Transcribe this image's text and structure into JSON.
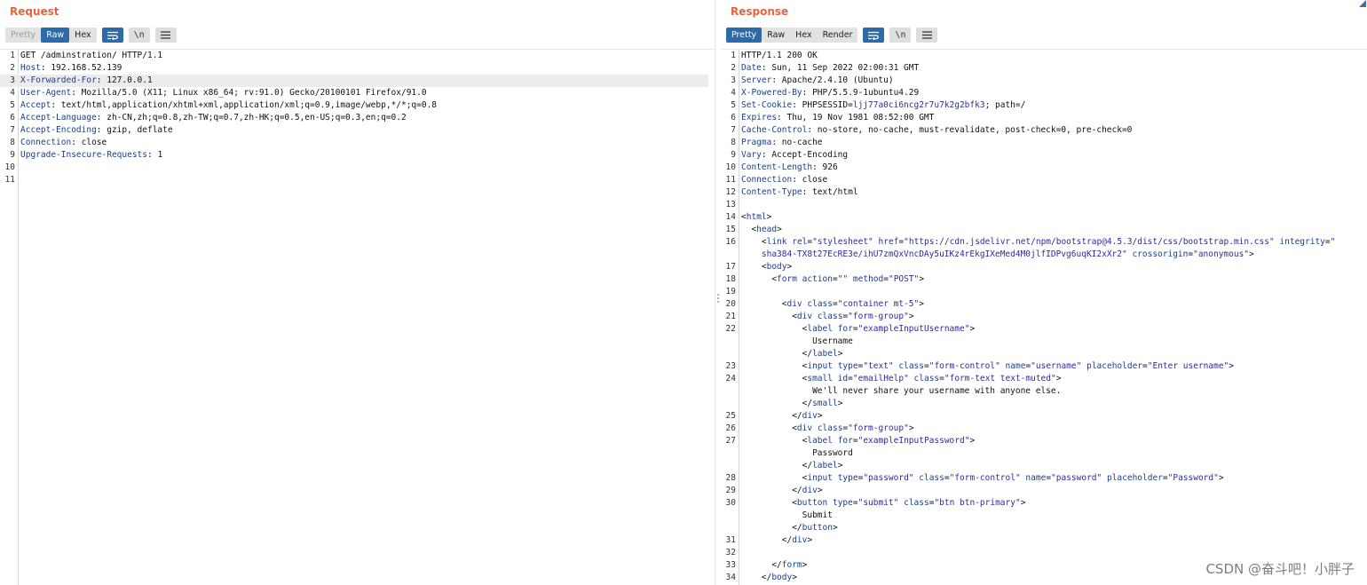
{
  "request": {
    "title": "Request",
    "tabs": [
      {
        "label": "Pretty",
        "state": "disabled"
      },
      {
        "label": "Raw",
        "state": "active"
      },
      {
        "label": "Hex",
        "state": "normal"
      }
    ],
    "newline_label": "\\n",
    "lines": [
      {
        "n": "1",
        "segs": [
          {
            "t": "GET /adminstration/ HTTP/1.1"
          }
        ]
      },
      {
        "n": "2",
        "segs": [
          {
            "t": "Host",
            "c": "hk"
          },
          {
            "t": ": 192.168.52.139"
          }
        ]
      },
      {
        "n": "3",
        "hl": true,
        "segs": [
          {
            "t": "X-Forwarded-For",
            "c": "hk"
          },
          {
            "t": ": 127.0.0.1"
          }
        ]
      },
      {
        "n": "4",
        "segs": [
          {
            "t": "User-Agent",
            "c": "hk"
          },
          {
            "t": ": Mozilla/5.0 (X11; Linux x86_64; rv:91.0) Gecko/20100101 Firefox/91.0"
          }
        ]
      },
      {
        "n": "5",
        "segs": [
          {
            "t": "Accept",
            "c": "hk"
          },
          {
            "t": ": text/html,application/xhtml+xml,application/xml;q=0.9,image/webp,*/*;q=0.8"
          }
        ]
      },
      {
        "n": "6",
        "segs": [
          {
            "t": "Accept-Language",
            "c": "hk"
          },
          {
            "t": ": zh-CN,zh;q=0.8,zh-TW;q=0.7,zh-HK;q=0.5,en-US;q=0.3,en;q=0.2"
          }
        ]
      },
      {
        "n": "7",
        "segs": [
          {
            "t": "Accept-Encoding",
            "c": "hk"
          },
          {
            "t": ": gzip, deflate"
          }
        ]
      },
      {
        "n": "8",
        "segs": [
          {
            "t": "Connection",
            "c": "hk"
          },
          {
            "t": ": close"
          }
        ]
      },
      {
        "n": "9",
        "segs": [
          {
            "t": "Upgrade-Insecure-Requests",
            "c": "hk"
          },
          {
            "t": ": 1"
          }
        ]
      },
      {
        "n": "10",
        "segs": []
      },
      {
        "n": "11",
        "segs": []
      }
    ]
  },
  "response": {
    "title": "Response",
    "tabs": [
      {
        "label": "Pretty",
        "state": "active"
      },
      {
        "label": "Raw",
        "state": "normal"
      },
      {
        "label": "Hex",
        "state": "normal"
      },
      {
        "label": "Render",
        "state": "normal"
      }
    ],
    "newline_label": "\\n",
    "lines": [
      {
        "n": "1",
        "segs": [
          {
            "t": "HTTP/1.1 200 OK"
          }
        ]
      },
      {
        "n": "2",
        "segs": [
          {
            "t": "Date",
            "c": "hk"
          },
          {
            "t": ": Sun, 11 Sep 2022 02:00:31 GMT"
          }
        ]
      },
      {
        "n": "3",
        "segs": [
          {
            "t": "Server",
            "c": "hk"
          },
          {
            "t": ": Apache/2.4.10 (Ubuntu)"
          }
        ]
      },
      {
        "n": "4",
        "segs": [
          {
            "t": "X-Powered-By",
            "c": "hk"
          },
          {
            "t": ": PHP/5.5.9-1ubuntu4.29"
          }
        ]
      },
      {
        "n": "5",
        "segs": [
          {
            "t": "Set-Cookie",
            "c": "hk"
          },
          {
            "t": ": PHPSESSID="
          },
          {
            "t": "ljj77a0ci6ncg2r7u7k2g2bfk3",
            "c": "av"
          },
          {
            "t": "; path=/"
          }
        ]
      },
      {
        "n": "6",
        "segs": [
          {
            "t": "Expires",
            "c": "hk"
          },
          {
            "t": ": Thu, 19 Nov 1981 08:52:00 GMT"
          }
        ]
      },
      {
        "n": "7",
        "segs": [
          {
            "t": "Cache-Control",
            "c": "hk"
          },
          {
            "t": ": no-store, no-cache, must-revalidate, post-check=0, pre-check=0"
          }
        ]
      },
      {
        "n": "8",
        "segs": [
          {
            "t": "Pragma",
            "c": "hk"
          },
          {
            "t": ": no-cache"
          }
        ]
      },
      {
        "n": "9",
        "segs": [
          {
            "t": "Vary",
            "c": "hk"
          },
          {
            "t": ": Accept-Encoding"
          }
        ]
      },
      {
        "n": "10",
        "segs": [
          {
            "t": "Content-Length",
            "c": "hk"
          },
          {
            "t": ": 926"
          }
        ]
      },
      {
        "n": "11",
        "segs": [
          {
            "t": "Connection",
            "c": "hk"
          },
          {
            "t": ": close"
          }
        ]
      },
      {
        "n": "12",
        "segs": [
          {
            "t": "Content-Type",
            "c": "hk"
          },
          {
            "t": ": text/html"
          }
        ]
      },
      {
        "n": "13",
        "segs": []
      },
      {
        "n": "14",
        "segs": [
          {
            "t": "<"
          },
          {
            "t": "html",
            "c": "tg"
          },
          {
            "t": ">"
          }
        ]
      },
      {
        "n": "15",
        "segs": [
          {
            "t": "  <"
          },
          {
            "t": "head",
            "c": "tg"
          },
          {
            "t": ">"
          }
        ]
      },
      {
        "n": "16",
        "segs": [
          {
            "t": "    <"
          },
          {
            "t": "link",
            "c": "tg"
          },
          {
            "t": " "
          },
          {
            "t": "rel",
            "c": "at"
          },
          {
            "t": "="
          },
          {
            "t": "\"stylesheet\"",
            "c": "av"
          },
          {
            "t": " "
          },
          {
            "t": "href",
            "c": "at"
          },
          {
            "t": "="
          },
          {
            "t": "\"https://cdn.jsdelivr.net/npm/bootstrap@4.5.3/dist/css/bootstrap.min.css\"",
            "c": "av"
          },
          {
            "t": " "
          },
          {
            "t": "integrity",
            "c": "at"
          },
          {
            "t": "="
          },
          {
            "t": "\"",
            "c": "av"
          }
        ]
      },
      {
        "n": "",
        "segs": [
          {
            "t": "    "
          },
          {
            "t": "sha384-TX8t27EcRE3e/ihU7zmQxVncDAy5uIKz4rEkgIXeMed4M0jlfIDPvg6uqKI2xXr2\"",
            "c": "av"
          },
          {
            "t": " "
          },
          {
            "t": "crossorigin",
            "c": "at"
          },
          {
            "t": "="
          },
          {
            "t": "\"anonymous\"",
            "c": "av"
          },
          {
            "t": ">"
          }
        ]
      },
      {
        "n": "17",
        "segs": [
          {
            "t": "    <"
          },
          {
            "t": "body",
            "c": "tg"
          },
          {
            "t": ">"
          }
        ]
      },
      {
        "n": "18",
        "segs": [
          {
            "t": "      <"
          },
          {
            "t": "form",
            "c": "tg"
          },
          {
            "t": " "
          },
          {
            "t": "action",
            "c": "at"
          },
          {
            "t": "="
          },
          {
            "t": "\"\"",
            "c": "av"
          },
          {
            "t": " "
          },
          {
            "t": "method",
            "c": "at"
          },
          {
            "t": "="
          },
          {
            "t": "\"POST\"",
            "c": "av"
          },
          {
            "t": ">"
          }
        ]
      },
      {
        "n": "19",
        "segs": []
      },
      {
        "n": "20",
        "segs": [
          {
            "t": "        <"
          },
          {
            "t": "div",
            "c": "tg"
          },
          {
            "t": " "
          },
          {
            "t": "class",
            "c": "at"
          },
          {
            "t": "="
          },
          {
            "t": "\"container mt-5\"",
            "c": "av"
          },
          {
            "t": ">"
          }
        ]
      },
      {
        "n": "21",
        "segs": [
          {
            "t": "          <"
          },
          {
            "t": "div",
            "c": "tg"
          },
          {
            "t": " "
          },
          {
            "t": "class",
            "c": "at"
          },
          {
            "t": "="
          },
          {
            "t": "\"form-group\"",
            "c": "av"
          },
          {
            "t": ">"
          }
        ]
      },
      {
        "n": "22",
        "segs": [
          {
            "t": "            <"
          },
          {
            "t": "label",
            "c": "tg"
          },
          {
            "t": " "
          },
          {
            "t": "for",
            "c": "at"
          },
          {
            "t": "="
          },
          {
            "t": "\"exampleInputUsername\"",
            "c": "av"
          },
          {
            "t": ">"
          }
        ]
      },
      {
        "n": "",
        "segs": [
          {
            "t": "              Username"
          }
        ]
      },
      {
        "n": "",
        "segs": [
          {
            "t": "            </"
          },
          {
            "t": "label",
            "c": "tg"
          },
          {
            "t": ">"
          }
        ]
      },
      {
        "n": "23",
        "segs": [
          {
            "t": "            <"
          },
          {
            "t": "input",
            "c": "tg"
          },
          {
            "t": " "
          },
          {
            "t": "type",
            "c": "at"
          },
          {
            "t": "="
          },
          {
            "t": "\"text\"",
            "c": "av"
          },
          {
            "t": " "
          },
          {
            "t": "class",
            "c": "at"
          },
          {
            "t": "="
          },
          {
            "t": "\"form-control\"",
            "c": "av"
          },
          {
            "t": " "
          },
          {
            "t": "name",
            "c": "at"
          },
          {
            "t": "="
          },
          {
            "t": "\"username\"",
            "c": "av"
          },
          {
            "t": " "
          },
          {
            "t": "placeholder",
            "c": "at"
          },
          {
            "t": "="
          },
          {
            "t": "\"Enter username\"",
            "c": "av"
          },
          {
            "t": ">"
          }
        ]
      },
      {
        "n": "24",
        "segs": [
          {
            "t": "            <"
          },
          {
            "t": "small",
            "c": "tg"
          },
          {
            "t": " "
          },
          {
            "t": "id",
            "c": "at"
          },
          {
            "t": "="
          },
          {
            "t": "\"emailHelp\"",
            "c": "av"
          },
          {
            "t": " "
          },
          {
            "t": "class",
            "c": "at"
          },
          {
            "t": "="
          },
          {
            "t": "\"form-text text-muted\"",
            "c": "av"
          },
          {
            "t": ">"
          }
        ]
      },
      {
        "n": "",
        "segs": [
          {
            "t": "              We'll never share your username with anyone else."
          }
        ]
      },
      {
        "n": "",
        "segs": [
          {
            "t": "            </"
          },
          {
            "t": "small",
            "c": "tg"
          },
          {
            "t": ">"
          }
        ]
      },
      {
        "n": "25",
        "segs": [
          {
            "t": "          </"
          },
          {
            "t": "div",
            "c": "tg"
          },
          {
            "t": ">"
          }
        ]
      },
      {
        "n": "26",
        "segs": [
          {
            "t": "          <"
          },
          {
            "t": "div",
            "c": "tg"
          },
          {
            "t": " "
          },
          {
            "t": "class",
            "c": "at"
          },
          {
            "t": "="
          },
          {
            "t": "\"form-group\"",
            "c": "av"
          },
          {
            "t": ">"
          }
        ]
      },
      {
        "n": "27",
        "segs": [
          {
            "t": "            <"
          },
          {
            "t": "label",
            "c": "tg"
          },
          {
            "t": " "
          },
          {
            "t": "for",
            "c": "at"
          },
          {
            "t": "="
          },
          {
            "t": "\"exampleInputPassword\"",
            "c": "av"
          },
          {
            "t": ">"
          }
        ]
      },
      {
        "n": "",
        "segs": [
          {
            "t": "              Password"
          }
        ]
      },
      {
        "n": "",
        "segs": [
          {
            "t": "            </"
          },
          {
            "t": "label",
            "c": "tg"
          },
          {
            "t": ">"
          }
        ]
      },
      {
        "n": "28",
        "segs": [
          {
            "t": "            <"
          },
          {
            "t": "input",
            "c": "tg"
          },
          {
            "t": " "
          },
          {
            "t": "type",
            "c": "at"
          },
          {
            "t": "="
          },
          {
            "t": "\"password\"",
            "c": "av"
          },
          {
            "t": " "
          },
          {
            "t": "class",
            "c": "at"
          },
          {
            "t": "="
          },
          {
            "t": "\"form-control\"",
            "c": "av"
          },
          {
            "t": " "
          },
          {
            "t": "name",
            "c": "at"
          },
          {
            "t": "="
          },
          {
            "t": "\"password\"",
            "c": "av"
          },
          {
            "t": " "
          },
          {
            "t": "placeholder",
            "c": "at"
          },
          {
            "t": "="
          },
          {
            "t": "\"Password\"",
            "c": "av"
          },
          {
            "t": ">"
          }
        ]
      },
      {
        "n": "29",
        "segs": [
          {
            "t": "          </"
          },
          {
            "t": "div",
            "c": "tg"
          },
          {
            "t": ">"
          }
        ]
      },
      {
        "n": "30",
        "segs": [
          {
            "t": "          <"
          },
          {
            "t": "button",
            "c": "tg"
          },
          {
            "t": " "
          },
          {
            "t": "type",
            "c": "at"
          },
          {
            "t": "="
          },
          {
            "t": "\"submit\"",
            "c": "av"
          },
          {
            "t": " "
          },
          {
            "t": "class",
            "c": "at"
          },
          {
            "t": "="
          },
          {
            "t": "\"btn btn-primary\"",
            "c": "av"
          },
          {
            "t": ">"
          }
        ]
      },
      {
        "n": "",
        "segs": [
          {
            "t": "            Submit"
          }
        ]
      },
      {
        "n": "",
        "segs": [
          {
            "t": "          </"
          },
          {
            "t": "button",
            "c": "tg"
          },
          {
            "t": ">"
          }
        ]
      },
      {
        "n": "31",
        "segs": [
          {
            "t": "        </"
          },
          {
            "t": "div",
            "c": "tg"
          },
          {
            "t": ">"
          }
        ]
      },
      {
        "n": "32",
        "segs": []
      },
      {
        "n": "33",
        "segs": [
          {
            "t": "      </"
          },
          {
            "t": "form",
            "c": "tg"
          },
          {
            "t": ">"
          }
        ]
      },
      {
        "n": "34",
        "segs": [
          {
            "t": "    </"
          },
          {
            "t": "body",
            "c": "tg"
          },
          {
            "t": ">"
          }
        ]
      }
    ]
  },
  "watermark": "CSDN @奋斗吧！小胖子",
  "colors": {
    "accent": "#e8633a",
    "active_tab": "#2d6aa8",
    "header_key": "#1c3f86",
    "attr_value": "#2d2d97"
  }
}
